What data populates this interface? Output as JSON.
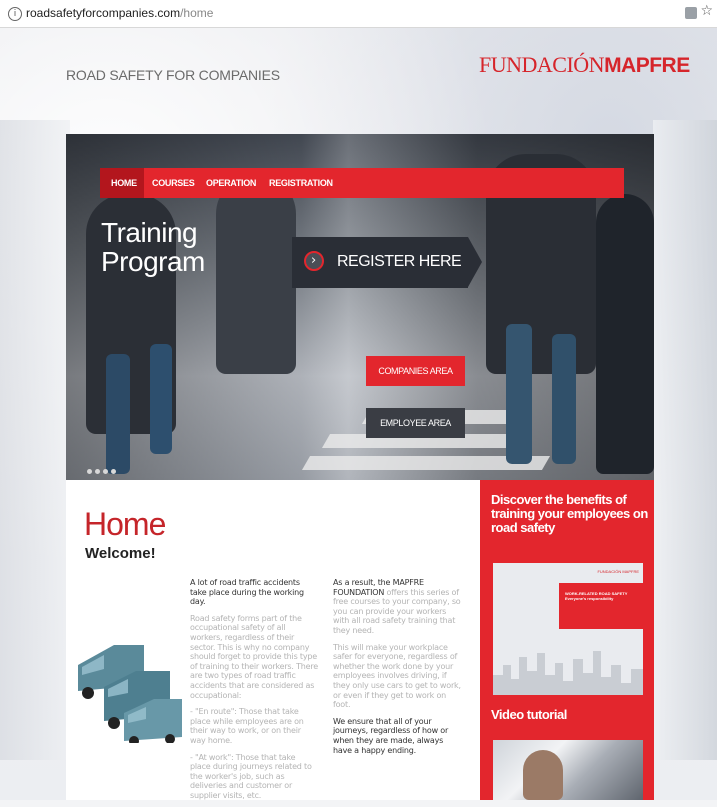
{
  "browser": {
    "url_domain": "roadsafetyforcompanies.com",
    "url_path": "/home",
    "icons": [
      "info-icon",
      "translate-icon",
      "star-icon"
    ]
  },
  "site": {
    "tagline": "ROAD SAFETY FOR COMPANIES",
    "logo_light": "FUNDACIÓN",
    "logo_bold": "MAPFRE",
    "brand_color": "#e3262d"
  },
  "nav": {
    "items": [
      "HOME",
      "COURSES",
      "OPERATION",
      "REGISTRATION"
    ],
    "active": "HOME"
  },
  "hero": {
    "title_line1": "Training",
    "title_line2": "Program",
    "register_label": "REGISTER HERE",
    "companies_label": "COMPANIES AREA",
    "employee_label": "EMPLOYEE AREA",
    "slide_count": 4
  },
  "content": {
    "title": "Home",
    "subtitle": "Welcome!",
    "col1": [
      "A lot of road traffic accidents take place during the working day.",
      "Road safety forms part of the occupational safety of all workers, regardless of their sector. This is why no company should forget to provide this type of training to their workers. There are two types of road traffic accidents that are considered as occupational:",
      "- \"En route\": Those that take place while employees are on their way to work, or on their way home.",
      "- \"At work\": Those that take place during journeys related to the worker's job, such as deliveries and customer or supplier visits, etc."
    ],
    "col2_prefix": "As a result, the MAPFRE FOUNDATION",
    "col2_rest": " offers this series of free courses to your company, so you can provide your workers with all road safety training that they need.",
    "col2_p2": "This will make your workplace safer for everyone, regardless of whether the work done by your employees involves driving, if they only use cars to get to work, or even if they get to work on foot.",
    "col2_p3": "We ensure that all of your journeys, regardless of how or when they are made, always have a happy ending."
  },
  "sidebar": {
    "title": "Discover the benefits of training your employees on road safety",
    "doc_brand": "FUNDACIÓN MAPFRE",
    "doc_title": "WORK-RELATED ROAD SAFETY",
    "doc_subtitle": "Everyone's responsibility",
    "video_title": "Video tutorial"
  }
}
